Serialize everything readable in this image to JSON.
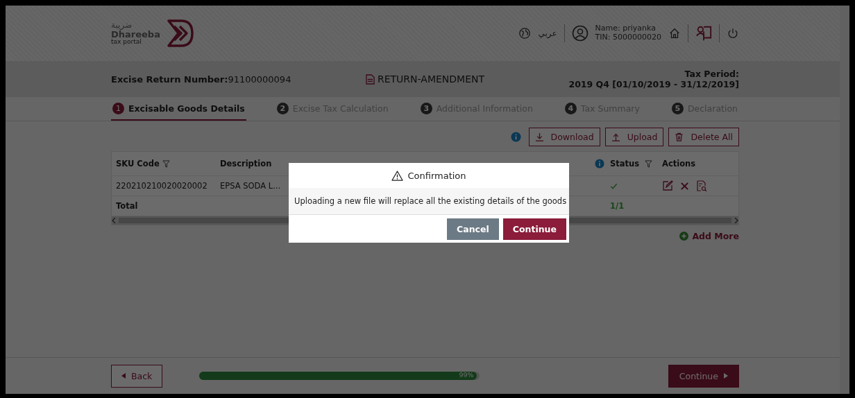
{
  "header": {
    "logo_arabic": "ضريبة",
    "logo_name": "Dhareeba",
    "logo_tagline": "tax portal",
    "language": "عربي",
    "user_name": "Name: priyanka",
    "user_tin": "TIN: 5000000020"
  },
  "return_bar": {
    "return_number_label": "Excise Return Number:",
    "return_number": "91100000094",
    "return_type": "RETURN-AMENDMENT",
    "tax_period_label": "Tax Period:",
    "tax_period": "2019 Q4 [01/10/2019 - 31/12/2019]"
  },
  "steps": [
    {
      "number": "1",
      "label": "Excisable Goods Details",
      "selected": true
    },
    {
      "number": "2",
      "label": "Excise Tax Calculation",
      "selected": false
    },
    {
      "number": "3",
      "label": "Additional Information",
      "selected": false
    },
    {
      "number": "4",
      "label": "Tax Summary",
      "selected": false
    },
    {
      "number": "5",
      "label": "Declaration",
      "selected": false
    }
  ],
  "toolbar": {
    "buttons": [
      {
        "kind": "download",
        "label": "Download"
      },
      {
        "kind": "upload",
        "label": "Upload"
      },
      {
        "kind": "delete",
        "label": "Delete All"
      }
    ]
  },
  "table": {
    "columns": [
      "SKU Code",
      "Description",
      "Status",
      "Actions"
    ],
    "rows": [
      {
        "sku": "220210210020020002",
        "description": "EPSA SODA L..."
      }
    ],
    "total_label": "Total",
    "status_count": "1/1"
  },
  "add_more": "Add More",
  "dialog": {
    "title": "Confirmation",
    "message": "Uploading a new file will replace all the existing details of the goods",
    "buttons": [
      {
        "kind": "secondary",
        "label": "Cancel"
      },
      {
        "kind": "primary",
        "label": "Continue"
      }
    ]
  },
  "footer": {
    "back": "Back",
    "progress": {
      "level": 0.99,
      "reading": "99%"
    },
    "continue": "Continue"
  }
}
